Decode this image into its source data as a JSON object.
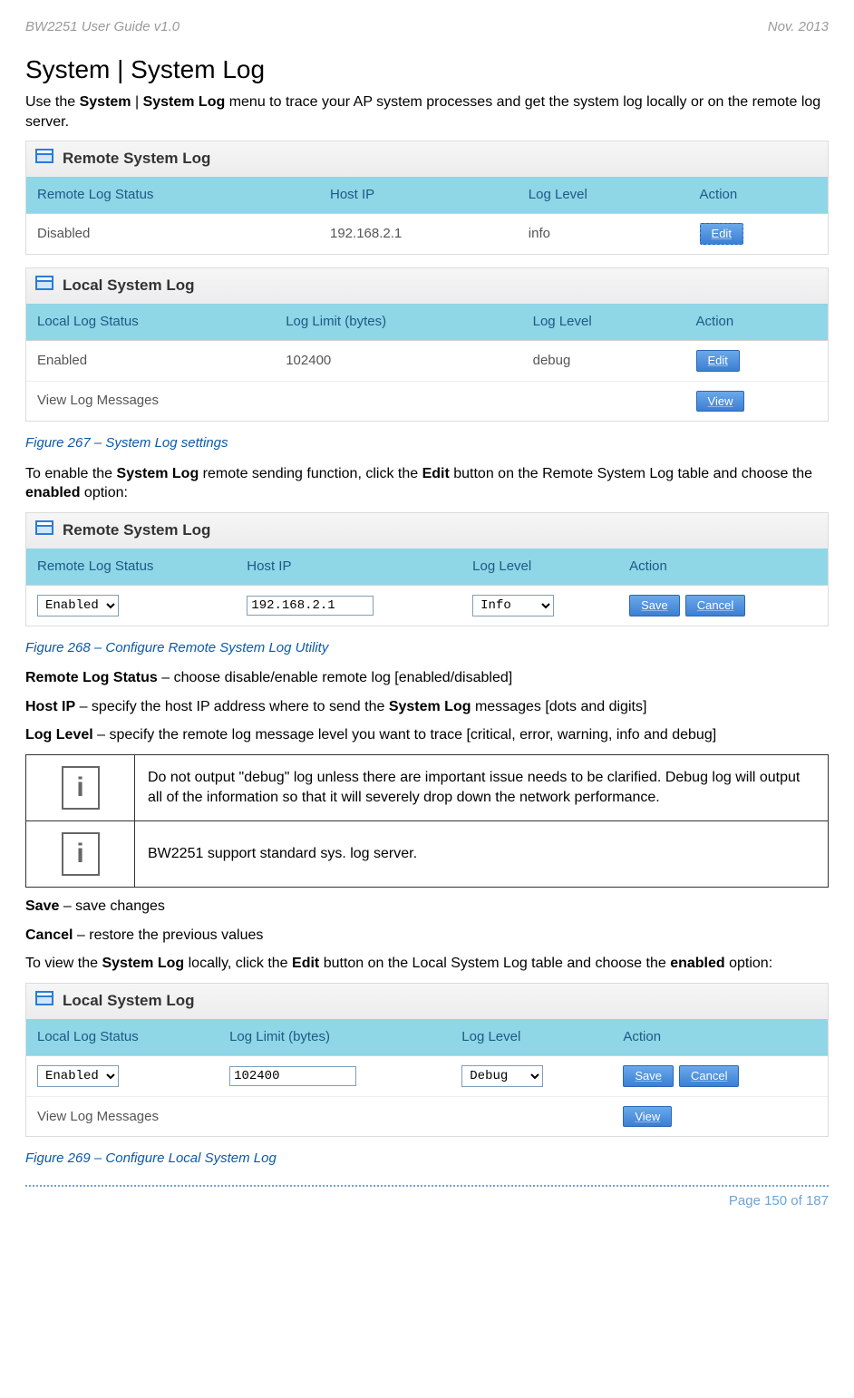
{
  "header": {
    "left": "BW2251 User Guide v1.0",
    "right": "Nov.  2013"
  },
  "title": "System | System Log",
  "intro_parts": {
    "pre": "Use the ",
    "b1": "System",
    "mid1": " | ",
    "b2": "System Log",
    "post": " menu to trace your AP system processes and get the system log locally or on the remote log server."
  },
  "panel1": {
    "title": "Remote System Log",
    "cols": [
      "Remote Log Status",
      "Host IP",
      "Log Level",
      "Action"
    ],
    "row": {
      "status": "Disabled",
      "host": "192.168.2.1",
      "level": "info",
      "action": "Edit"
    }
  },
  "panel2": {
    "title": "Local System Log",
    "cols": [
      "Local Log Status",
      "Log Limit (bytes)",
      "Log Level",
      "Action"
    ],
    "row": {
      "status": "Enabled",
      "limit": "102400",
      "level": "debug",
      "action": "Edit"
    },
    "row2": {
      "label": "View Log Messages",
      "action": "View"
    }
  },
  "fig267": "Figure 267 – System Log settings",
  "para2": {
    "pre": "To enable the ",
    "b1": "System Log",
    "mid1": " remote sending function, click the ",
    "b2": "Edit",
    "mid2": " button on the Remote System Log table and choose the ",
    "b3": "enabled",
    "post": " option:"
  },
  "panel3": {
    "title": "Remote System Log",
    "cols": [
      "Remote Log Status",
      "Host IP",
      "Log Level",
      "Action"
    ],
    "status_options": [
      "Enabled"
    ],
    "status_value": "Enabled",
    "host_value": "192.168.2.1",
    "level_options": [
      "Info"
    ],
    "level_value": "Info",
    "btn_save": "Save",
    "btn_cancel": "Cancel"
  },
  "fig268": "Figure 268 – Configure Remote System Log Utility",
  "def_rls": {
    "b": "Remote Log Status",
    "t": " – choose disable/enable remote log [enabled/disabled]"
  },
  "def_host": {
    "b": "Host IP",
    "t1": " – specify the host IP address where to send the ",
    "b2": "System Log",
    "t2": " messages [dots and digits]"
  },
  "def_ll": {
    "b": "Log Level",
    "t": " – specify the remote log message level you want to trace [critical, error, warning, info and debug]"
  },
  "info1": "Do not output \"debug\" log unless there are important issue needs to be clarified. Debug log will output all of the information so that it will severely drop down the network performance.",
  "info2": "BW2251 support standard sys. log server.",
  "def_save": {
    "b": "Save",
    "t": " – save changes"
  },
  "def_cancel": {
    "b": "Cancel",
    "t": " – restore the previous values"
  },
  "para3": {
    "pre": "To view the ",
    "b1": "System Log",
    "mid1": " locally, click the ",
    "b2": "Edit",
    "mid2": " button on the Local System Log table and choose the ",
    "b3": "enabled",
    "post": " option:"
  },
  "panel4": {
    "title": "Local System Log",
    "cols": [
      "Local Log Status",
      "Log Limit (bytes)",
      "Log Level",
      "Action"
    ],
    "status_options": [
      "Enabled"
    ],
    "status_value": "Enabled",
    "limit_value": "102400",
    "level_options": [
      "Debug"
    ],
    "level_value": "Debug",
    "btn_save": "Save",
    "btn_cancel": "Cancel",
    "row2": {
      "label": "View Log Messages",
      "action": "View"
    }
  },
  "fig269": "Figure 269 – Configure Local System Log",
  "footer": "Page 150 of 187"
}
